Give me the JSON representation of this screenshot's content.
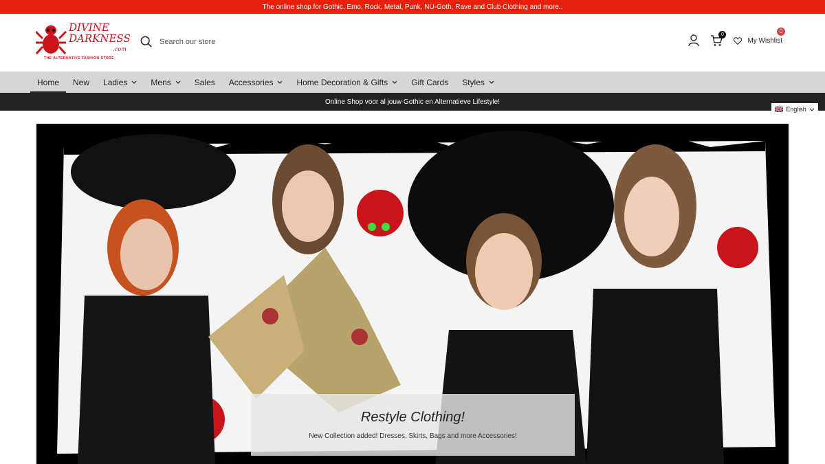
{
  "announcement": "The online shop for Gothic, Emo, Rock, Metal, Punk, NU-Goth, Rave and Club Clothing and more..",
  "logo": {
    "line1": "DIVINE",
    "line2": "DARKNESS",
    "suffix": ".com",
    "tagline": "THE ALTERNATIVE FASHION STORE"
  },
  "search": {
    "placeholder": "Search our store"
  },
  "cart": {
    "count": "0"
  },
  "wishlist": {
    "label": "My Wishlist",
    "count": "0"
  },
  "nav": {
    "items": [
      {
        "label": "Home"
      },
      {
        "label": "New"
      },
      {
        "label": "Ladies"
      },
      {
        "label": "Mens"
      },
      {
        "label": "Sales"
      },
      {
        "label": "Accessories"
      },
      {
        "label": "Home Decoration & Gifts"
      },
      {
        "label": "Gift Cards"
      },
      {
        "label": "Styles"
      }
    ]
  },
  "subbar": "Online Shop voor al jouw Gothic en Alternatieve Lifestyle!",
  "language": {
    "selected": "English"
  },
  "hero": {
    "title": "Restyle Clothing!",
    "subtitle": "New Collection added! Dresses, Skirts, Bags and more Accessories!"
  },
  "colors": {
    "accent": "#e8200d",
    "nav_bg": "#d6d6d6",
    "dark": "#222222"
  }
}
